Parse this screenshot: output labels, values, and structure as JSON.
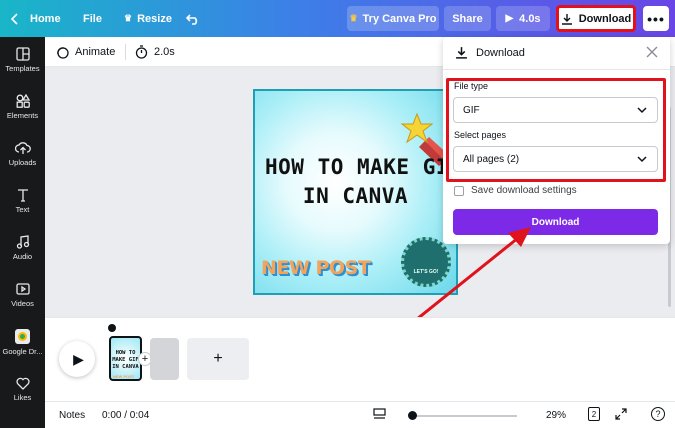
{
  "topbar": {
    "home": "Home",
    "file": "File",
    "resize": "Resize",
    "try_pro": "Try Canva Pro",
    "share": "Share",
    "play_duration": "4.0s",
    "download": "Download"
  },
  "sidebar": {
    "items": [
      {
        "label": "Templates",
        "icon": "templates-icon"
      },
      {
        "label": "Elements",
        "icon": "elements-icon"
      },
      {
        "label": "Uploads",
        "icon": "uploads-icon"
      },
      {
        "label": "Text",
        "icon": "text-icon"
      },
      {
        "label": "Audio",
        "icon": "audio-icon"
      },
      {
        "label": "Videos",
        "icon": "videos-icon"
      },
      {
        "label": "Google Dr...",
        "icon": "google-drive-icon"
      },
      {
        "label": "Likes",
        "icon": "heart-icon"
      }
    ]
  },
  "toolbar": {
    "animate": "Animate",
    "duration": "2.0s"
  },
  "design": {
    "title_line1": "HOW TO MAKE GIF",
    "title_line2": "IN CANVA",
    "sub": "NEW POST",
    "badge": "LET'S GO!"
  },
  "download_panel": {
    "title": "Download",
    "file_type_label": "File type",
    "file_type_value": "GIF",
    "select_pages_label": "Select pages",
    "select_pages_value": "All pages (2)",
    "save_settings_label": "Save download settings",
    "download_button": "Download"
  },
  "pages": {
    "thumb_text": "HOW TO MAKE GIF IN CANVA",
    "thumb_sub": "NEW POST",
    "add": "+"
  },
  "footer": {
    "notes": "Notes",
    "time": "0:00 / 0:04",
    "zoom": "29%",
    "page_count": "2",
    "help": "?"
  },
  "colors": {
    "accent": "#8b3dff",
    "annotation": "#e0121b"
  }
}
